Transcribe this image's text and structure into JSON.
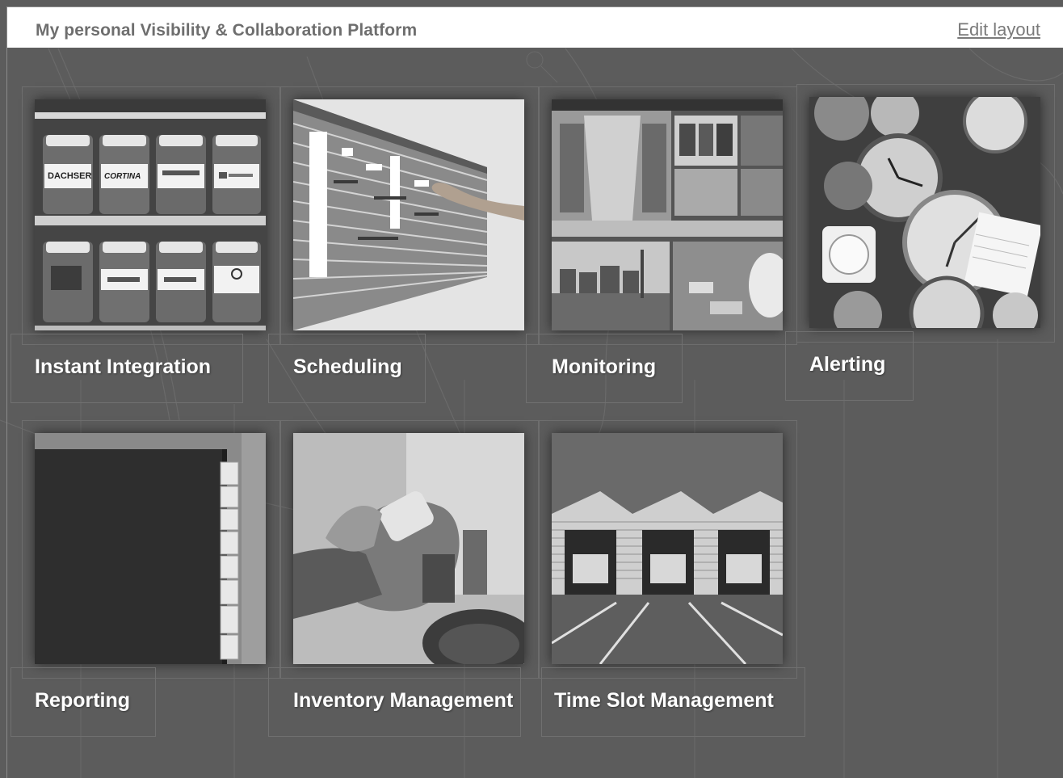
{
  "header": {
    "title": "My personal Visibility & Collaboration Platform",
    "edit_layout": "Edit layout"
  },
  "tiles": [
    {
      "label": "Instant Integration",
      "image": "jars-on-shelves-photo"
    },
    {
      "label": "Scheduling",
      "image": "planning-board-photo"
    },
    {
      "label": "Monitoring",
      "image": "warehouse-and-port-collage-photo"
    },
    {
      "label": "Alerting",
      "image": "alarm-clocks-pile-photo"
    },
    {
      "label": "Reporting",
      "image": "file-folder-tabs-photo"
    },
    {
      "label": "Inventory Management",
      "image": "hand-scanner-forklift-photo"
    },
    {
      "label": "Time Slot Management",
      "image": "loading-docks-photo"
    }
  ],
  "jar_labels": [
    "DACHSER",
    "CORTINA",
    "",
    "",
    "",
    "",
    "",
    ""
  ]
}
